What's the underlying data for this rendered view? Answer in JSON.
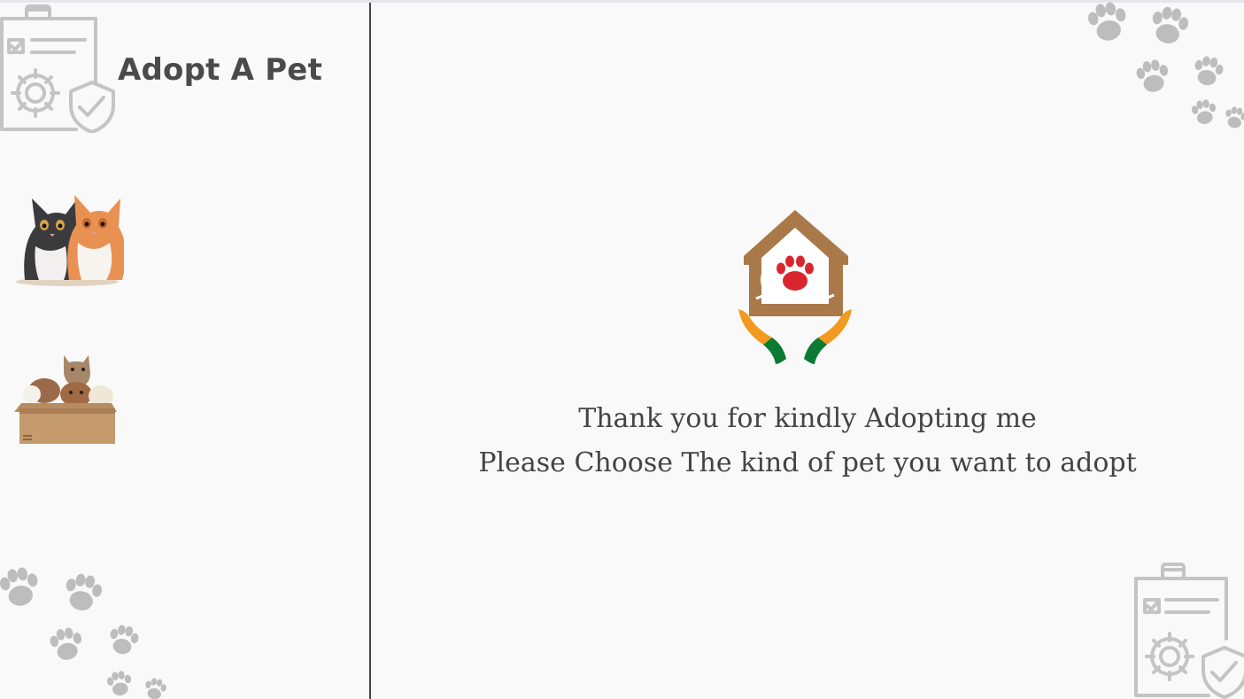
{
  "app": {
    "title": "Adopt A Pet"
  },
  "sidebar": {
    "items": [
      {
        "name": "cats",
        "icon": "cats-icon"
      },
      {
        "name": "dogs",
        "icon": "dogs-in-box-icon"
      }
    ]
  },
  "main": {
    "logo": "house-paw-hands-logo",
    "message_line1": "Thank you for kindly Adopting me",
    "message_line2": "Please Choose The kind of pet you want to adopt"
  },
  "colors": {
    "background": "#f9f9f9",
    "divider": "#444444",
    "title": "#4a4a4a",
    "paw": "#bdbdbd",
    "logo_brown": "#a9794a",
    "logo_orange": "#f29a1f",
    "logo_green": "#0b7a35",
    "logo_red": "#d9262e"
  }
}
